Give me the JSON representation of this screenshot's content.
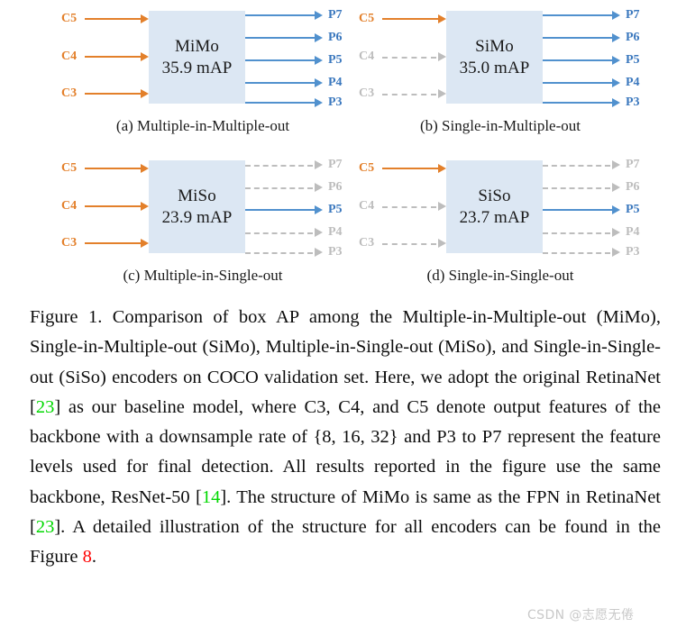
{
  "figure": {
    "panels": [
      {
        "id": "a",
        "caption": "(a) Multiple-in-Multiple-out",
        "encoder_name": "MiMo",
        "encoder_map": "35.9 mAP",
        "inputs": [
          {
            "label": "C5",
            "state": "active"
          },
          {
            "label": "C4",
            "state": "active"
          },
          {
            "label": "C3",
            "state": "active"
          }
        ],
        "outputs": [
          {
            "label": "P7",
            "state": "active"
          },
          {
            "label": "P6",
            "state": "active"
          },
          {
            "label": "P5",
            "state": "active"
          },
          {
            "label": "P4",
            "state": "active"
          },
          {
            "label": "P3",
            "state": "active"
          }
        ]
      },
      {
        "id": "b",
        "caption": "(b) Single-in-Multiple-out",
        "encoder_name": "SiMo",
        "encoder_map": "35.0 mAP",
        "inputs": [
          {
            "label": "C5",
            "state": "active"
          },
          {
            "label": "C4",
            "state": "inactive"
          },
          {
            "label": "C3",
            "state": "inactive"
          }
        ],
        "outputs": [
          {
            "label": "P7",
            "state": "active"
          },
          {
            "label": "P6",
            "state": "active"
          },
          {
            "label": "P5",
            "state": "active"
          },
          {
            "label": "P4",
            "state": "active"
          },
          {
            "label": "P3",
            "state": "active"
          }
        ]
      },
      {
        "id": "c",
        "caption": "(c) Multiple-in-Single-out",
        "encoder_name": "MiSo",
        "encoder_map": "23.9 mAP",
        "inputs": [
          {
            "label": "C5",
            "state": "active"
          },
          {
            "label": "C4",
            "state": "active"
          },
          {
            "label": "C3",
            "state": "active"
          }
        ],
        "outputs": [
          {
            "label": "P7",
            "state": "inactive"
          },
          {
            "label": "P6",
            "state": "inactive"
          },
          {
            "label": "P5",
            "state": "active"
          },
          {
            "label": "P4",
            "state": "inactive"
          },
          {
            "label": "P3",
            "state": "inactive"
          }
        ]
      },
      {
        "id": "d",
        "caption": "(d) Single-in-Single-out",
        "encoder_name": "SiSo",
        "encoder_map": "23.7 mAP",
        "inputs": [
          {
            "label": "C5",
            "state": "active"
          },
          {
            "label": "C4",
            "state": "inactive"
          },
          {
            "label": "C3",
            "state": "inactive"
          }
        ],
        "outputs": [
          {
            "label": "P7",
            "state": "inactive"
          },
          {
            "label": "P6",
            "state": "inactive"
          },
          {
            "label": "P5",
            "state": "active"
          },
          {
            "label": "P4",
            "state": "inactive"
          },
          {
            "label": "P3",
            "state": "inactive"
          }
        ]
      }
    ]
  },
  "caption": {
    "segments": [
      {
        "text": "Figure 1. Comparison of box AP among the Multiple-in-Multiple-out (MiMo), Single-in-Multiple-out (SiMo), Multiple-in-Single-out (MiSo), and Single-in-Single-out (SiSo) encoders on COCO validation set. Here, we adopt the original RetinaNet [",
        "style": "normal"
      },
      {
        "text": "23",
        "style": "ref-green"
      },
      {
        "text": "] as our baseline model, where C3, C4, and C5 denote output features of the backbone with a downsample rate of {8, 16, 32} and P3 to P7 represent the feature levels used for final detection. All results reported in the figure use the same backbone, ResNet-50 [",
        "style": "normal"
      },
      {
        "text": "14",
        "style": "ref-green"
      },
      {
        "text": "]. The structure of MiMo is same as the FPN in RetinaNet [",
        "style": "normal"
      },
      {
        "text": "23",
        "style": "ref-green"
      },
      {
        "text": "]. A detailed illustration of the structure for all encoders can be found in the Figure ",
        "style": "normal"
      },
      {
        "text": "8",
        "style": "ref-red"
      },
      {
        "text": ".",
        "style": "normal"
      }
    ]
  },
  "watermark": {
    "text": "CSDN @志愿无倦"
  },
  "colors": {
    "orange": "#E3802B",
    "blue": "#5191CE",
    "blue_label": "#3B78BE",
    "gray": "#BDBDBD",
    "box_fill": "#DCE7F3",
    "ref_green": "#00D800",
    "ref_red": "#FF0000",
    "watermark": "#C9C9C9"
  }
}
